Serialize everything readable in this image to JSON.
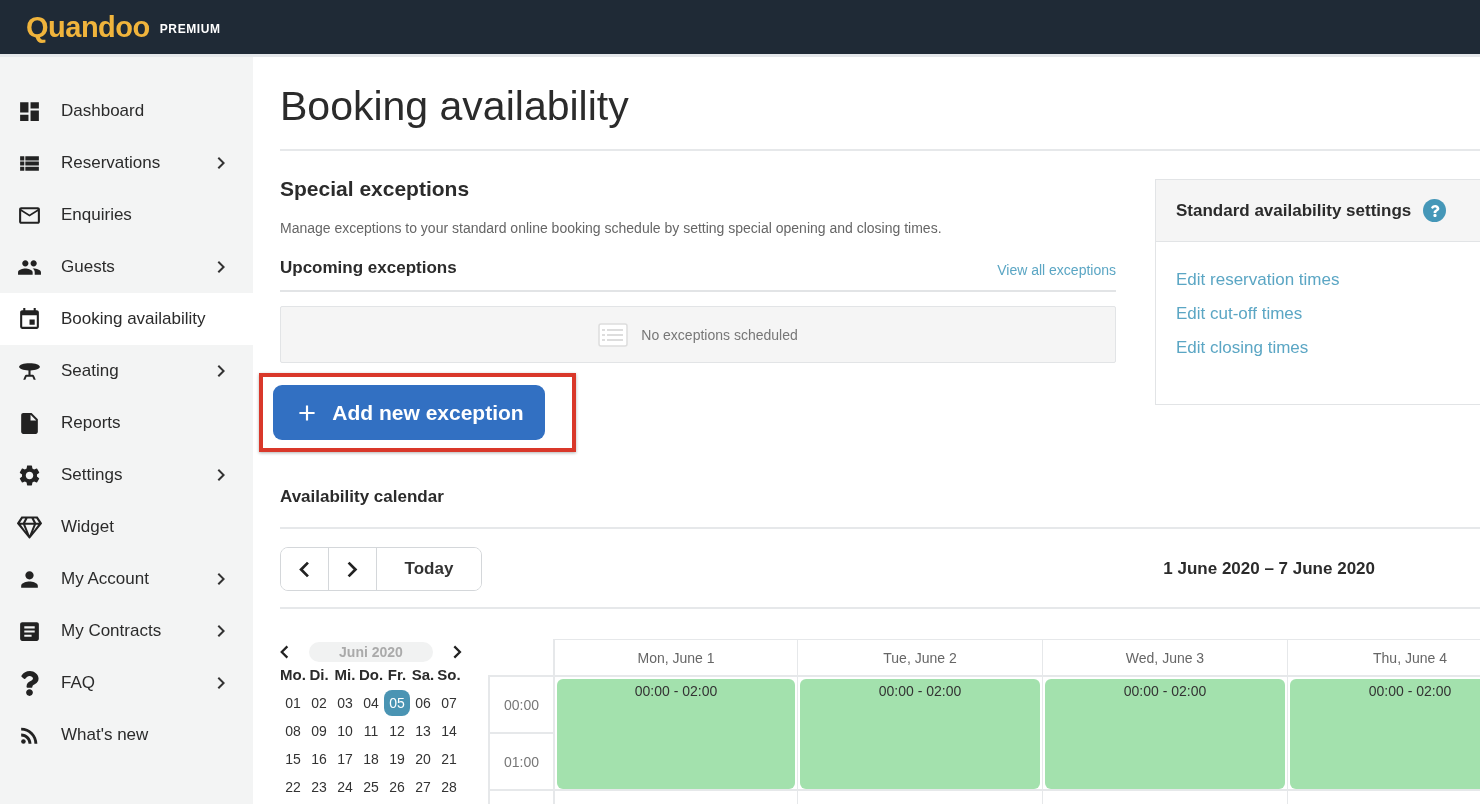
{
  "header": {
    "logo": "Quandoo",
    "badge": "PREMIUM"
  },
  "sidebar": {
    "items": [
      {
        "label": "Dashboard",
        "has_submenu": false,
        "selected": false
      },
      {
        "label": "Reservations",
        "has_submenu": true,
        "selected": false
      },
      {
        "label": "Enquiries",
        "has_submenu": false,
        "selected": false
      },
      {
        "label": "Guests",
        "has_submenu": true,
        "selected": false
      },
      {
        "label": "Booking availability",
        "has_submenu": false,
        "selected": true
      },
      {
        "label": "Seating",
        "has_submenu": true,
        "selected": false
      },
      {
        "label": "Reports",
        "has_submenu": false,
        "selected": false
      },
      {
        "label": "Settings",
        "has_submenu": true,
        "selected": false
      },
      {
        "label": "Widget",
        "has_submenu": false,
        "selected": false
      },
      {
        "label": "My Account",
        "has_submenu": true,
        "selected": false
      },
      {
        "label": "My Contracts",
        "has_submenu": true,
        "selected": false
      },
      {
        "label": "FAQ",
        "has_submenu": true,
        "selected": false
      },
      {
        "label": "What's new",
        "has_submenu": false,
        "selected": false
      }
    ]
  },
  "page_title": "Booking availability",
  "special_exceptions": {
    "title": "Special exceptions",
    "description": "Manage exceptions to your standard online booking schedule by setting special opening and closing times.",
    "upcoming_title": "Upcoming exceptions",
    "view_all_link": "View all exceptions",
    "empty_message": "No exceptions scheduled",
    "add_button": {
      "label": "Add new exception",
      "highlighted": true
    }
  },
  "standard_settings": {
    "title": "Standard availability settings",
    "links": [
      "Edit reservation times",
      "Edit cut-off times",
      "Edit closing times"
    ]
  },
  "availability_calendar": {
    "title": "Availability calendar",
    "today_button": "Today",
    "range": "1 June 2020 – 7 June 2020",
    "mini_calendar": {
      "month": "Juni 2020",
      "weekdays": [
        "Mo.",
        "Di.",
        "Mi.",
        "Do.",
        "Fr.",
        "Sa.",
        "So."
      ],
      "weeks": [
        [
          {
            "day": "01",
            "selected": false
          },
          {
            "day": "02",
            "selected": false
          },
          {
            "day": "03",
            "selected": false
          },
          {
            "day": "04",
            "selected": false
          },
          {
            "day": "05",
            "selected": true
          },
          {
            "day": "06",
            "selected": false
          },
          {
            "day": "07",
            "selected": false
          }
        ],
        [
          {
            "day": "08",
            "selected": false
          },
          {
            "day": "09",
            "selected": false
          },
          {
            "day": "10",
            "selected": false
          },
          {
            "day": "11",
            "selected": false
          },
          {
            "day": "12",
            "selected": false
          },
          {
            "day": "13",
            "selected": false
          },
          {
            "day": "14",
            "selected": false
          }
        ],
        [
          {
            "day": "15",
            "selected": false
          },
          {
            "day": "16",
            "selected": false
          },
          {
            "day": "17",
            "selected": false
          },
          {
            "day": "18",
            "selected": false
          },
          {
            "day": "19",
            "selected": false
          },
          {
            "day": "20",
            "selected": false
          },
          {
            "day": "21",
            "selected": false
          }
        ],
        [
          {
            "day": "22",
            "selected": false
          },
          {
            "day": "23",
            "selected": false
          },
          {
            "day": "24",
            "selected": false
          },
          {
            "day": "25",
            "selected": false
          },
          {
            "day": "26",
            "selected": false
          },
          {
            "day": "27",
            "selected": false
          },
          {
            "day": "28",
            "selected": false
          }
        ]
      ]
    },
    "times": [
      "00:00",
      "01:00"
    ],
    "days": [
      {
        "label": "Mon, June 1",
        "slot": "00:00 - 02:00"
      },
      {
        "label": "Tue, June 2",
        "slot": "00:00 - 02:00"
      },
      {
        "label": "Wed, June 3",
        "slot": "00:00 - 02:00"
      },
      {
        "label": "Thu, June 4",
        "slot": "00:00 - 02:00"
      }
    ]
  }
}
